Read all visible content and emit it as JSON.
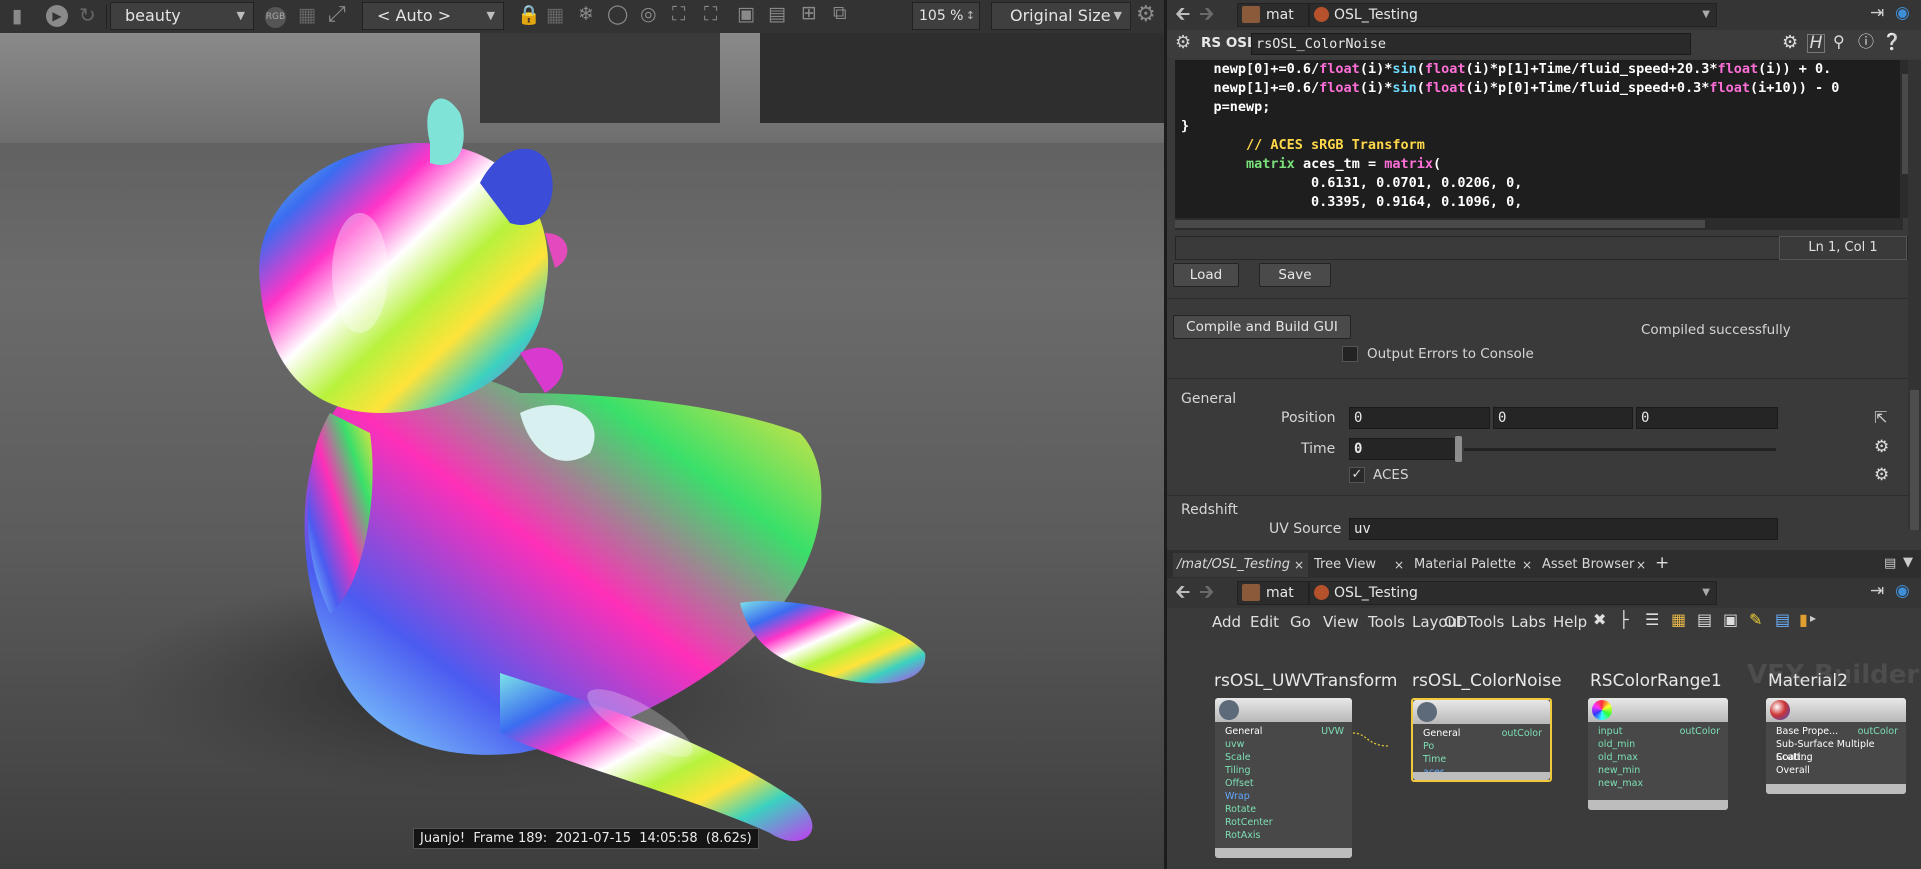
{
  "render_view": {
    "aov": "beauty",
    "camera": "< Auto >",
    "zoom": "105 %",
    "size_mode": "Original Size",
    "status_text": "Juanjo!  Frame 189:  2021-07-15  14:05:58  (8.62s)",
    "icons": [
      "clapper-icon",
      "play-icon",
      "refresh-icon",
      "aov-icon",
      "grid-icon",
      "crop-icon",
      "lock-icon",
      "tiles-icon",
      "snowflake-icon",
      "circle-icon",
      "target-icon",
      "focus-icon",
      "fit-icon",
      "resize-icon",
      "image-icon",
      "snapshot-add-icon",
      "copy-icon",
      "gear-icon"
    ]
  },
  "param_pane": {
    "path_root": "mat",
    "path_node": "OSL_Testing",
    "node_type": "RS OSL",
    "node_name": "rsOSL_ColorNoise",
    "code_lines": [
      "    newp[0]+=0.6/float(i)*sin(float(i)*p[1]+Time/fluid_speed+20.3*float(i)) + 0.",
      "    newp[1]+=0.6/float(i)*sin(float(i)*p[0]+Time/fluid_speed+0.3*float(i+10)) - 0",
      "    p=newp;",
      "}",
      "        // ACES sRGB Transform",
      "        matrix aces_tm = matrix(",
      "                0.6131, 0.0701, 0.0206, 0,",
      "                0.3395, 0.9164, 0.1096, 0,"
    ],
    "cursor_pos": "Ln 1, Col 1",
    "load_label": "Load",
    "save_label": "Save",
    "compile_label": "Compile and Build GUI",
    "compile_status": "Compiled successfully",
    "output_errors_label": "Output Errors to Console",
    "general_label": "General",
    "position_label": "Position",
    "position": [
      "0",
      "0",
      "0"
    ],
    "time_label": "Time",
    "time_value": "0",
    "aces_label": "ACES",
    "aces_checked": true,
    "redshift_label": "Redshift",
    "uv_source_label": "UV Source",
    "uv_source": "uv"
  },
  "network_pane": {
    "tabs": [
      "/mat/OSL_Testing",
      "Tree View",
      "Material Palette",
      "Asset Browser"
    ],
    "path_root": "mat",
    "path_node": "OSL_Testing",
    "menu": [
      "Add",
      "Edit",
      "Go",
      "View",
      "Tools",
      "Layout",
      "ODTools",
      "Labs",
      "Help"
    ],
    "watermark": "VEX Builder",
    "nodes": [
      {
        "title": "rsOSL_UWVTransform",
        "inputs": [
          "General",
          "uvw",
          "Scale",
          "Tiling",
          "Offset",
          "Wrap",
          "Rotate",
          "RotCenter",
          "RotAxis"
        ],
        "output": "UVW"
      },
      {
        "title": "rsOSL_ColorNoise",
        "inputs": [
          "General",
          "Po",
          "Time",
          "aces"
        ],
        "output": "outColor"
      },
      {
        "title": "RSColorRange1",
        "inputs": [
          "input",
          "old_min",
          "old_max",
          "new_min",
          "new_max"
        ],
        "output": "outColor"
      },
      {
        "title": "Material2",
        "inputs": [
          "Base Prope...",
          "Sub-Surface Multiple Scatt...",
          "Coating",
          "Overall"
        ],
        "output": "outColor"
      }
    ]
  }
}
